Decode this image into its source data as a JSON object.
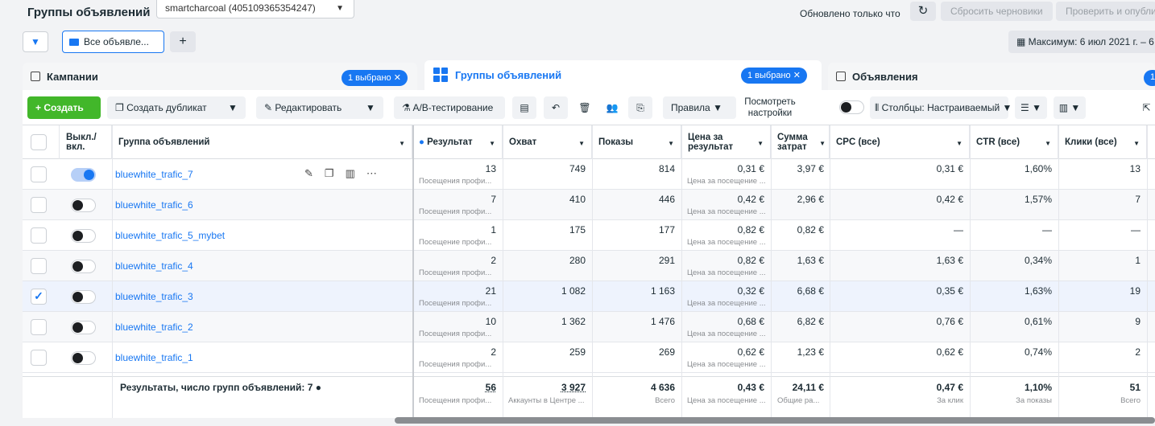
{
  "header": {
    "title": "Группы объявлений",
    "account": "smartcharcoal (405109365354247)",
    "updated": "Обновлено только что",
    "reset_drafts": "Сбросить черновики",
    "review_publish": "Проверить и опубли"
  },
  "filters": {
    "all_ads": "Все объявле...",
    "date_range": "Максимум: 6 июл 2021 г. – 6"
  },
  "tabs": [
    {
      "label": "Кампании",
      "selected": "1 выбрано"
    },
    {
      "label": "Группы объявлений",
      "selected": "1 выбрано"
    },
    {
      "label": "Объявления",
      "selected": "1"
    }
  ],
  "toolbar": {
    "create": "Создать",
    "duplicate": "Создать дубликат",
    "edit": "Редактировать",
    "ab_test": "A/B-тестирование",
    "rules": "Правила",
    "view_settings": "Посмотреть настройки",
    "columns": "Столбцы: Настраиваемый"
  },
  "columns": {
    "toggle": "Выкл./ вкл.",
    "adset": "Группа объявлений",
    "result": "Результат",
    "reach": "Охват",
    "impressions": "Показы",
    "cost_per_result": "Цена за результат",
    "amount_spent": "Сумма затрат",
    "cpc": "CPC (все)",
    "ctr": "CTR (все)",
    "clicks": "Клики (все)"
  },
  "rows": [
    {
      "name": "bluewhite_trafic_7",
      "on": true,
      "checked": false,
      "result": "13",
      "result_sub": "Посещения профи...",
      "reach": "749",
      "impressions": "814",
      "cpr": "0,31 €",
      "cpr_sub": "Цена за посещение ...",
      "spent": "3,97 €",
      "cpc": "0,31 €",
      "ctr": "1,60%",
      "clicks": "13"
    },
    {
      "name": "bluewhite_trafic_6",
      "on": false,
      "checked": false,
      "result": "7",
      "result_sub": "Посещения профи...",
      "reach": "410",
      "impressions": "446",
      "cpr": "0,42 €",
      "cpr_sub": "Цена за посещение ...",
      "spent": "2,96 €",
      "cpc": "0,42 €",
      "ctr": "1,57%",
      "clicks": "7"
    },
    {
      "name": "bluewhite_trafic_5_mybet",
      "on": false,
      "checked": false,
      "result": "1",
      "result_sub": "Посещение профи...",
      "reach": "175",
      "impressions": "177",
      "cpr": "0,82 €",
      "cpr_sub": "Цена за посещение ...",
      "spent": "0,82 €",
      "cpc": "—",
      "ctr": "—",
      "clicks": "—"
    },
    {
      "name": "bluewhite_trafic_4",
      "on": false,
      "checked": false,
      "result": "2",
      "result_sub": "Посещения профи...",
      "reach": "280",
      "impressions": "291",
      "cpr": "0,82 €",
      "cpr_sub": "Цена за посещение ...",
      "spent": "1,63 €",
      "cpc": "1,63 €",
      "ctr": "0,34%",
      "clicks": "1"
    },
    {
      "name": "bluewhite_trafic_3",
      "on": false,
      "checked": true,
      "result": "21",
      "result_sub": "Посещения профи...",
      "reach": "1 082",
      "impressions": "1 163",
      "cpr": "0,32 €",
      "cpr_sub": "Цена за посещение ...",
      "spent": "6,68 €",
      "cpc": "0,35 €",
      "ctr": "1,63%",
      "clicks": "19"
    },
    {
      "name": "bluewhite_trafic_2",
      "on": false,
      "checked": false,
      "result": "10",
      "result_sub": "Посещения профи...",
      "reach": "1 362",
      "impressions": "1 476",
      "cpr": "0,68 €",
      "cpr_sub": "Цена за посещение ...",
      "spent": "6,82 €",
      "cpc": "0,76 €",
      "ctr": "0,61%",
      "clicks": "9"
    },
    {
      "name": "bluewhite_trafic_1",
      "on": false,
      "checked": false,
      "result": "2",
      "result_sub": "Посещения профи...",
      "reach": "259",
      "impressions": "269",
      "cpr": "0,62 €",
      "cpr_sub": "Цена за посещение ...",
      "spent": "1,23 €",
      "cpc": "0,62 €",
      "ctr": "0,74%",
      "clicks": "2"
    }
  ],
  "summary": {
    "title": "Результаты, число групп объявлений: 7",
    "result": "56",
    "result_sub": "Посещения профи...",
    "reach": "3 927",
    "reach_sub": "Аккаунты в Центре ...",
    "impressions": "4 636",
    "impressions_sub": "Всего",
    "cpr": "0,43 €",
    "cpr_sub": "Цена за посещение ...",
    "spent": "24,11 €",
    "spent_sub": "Общие ра...",
    "cpc": "0,47 €",
    "cpc_sub": "За клик",
    "ctr": "1,10%",
    "ctr_sub": "За показы",
    "clicks": "51",
    "clicks_sub": "Всего"
  }
}
